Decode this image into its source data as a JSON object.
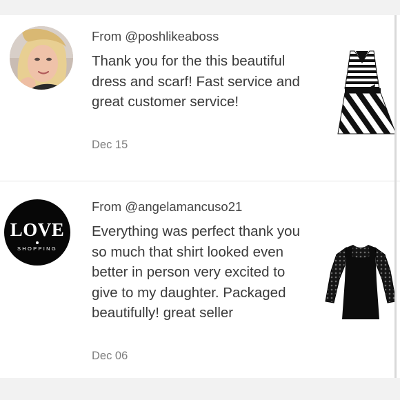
{
  "reviews": [
    {
      "from": "From @poshlikeaboss",
      "text": "Thank you for the this beautiful dress and scarf! Fast service and great customer service!",
      "date": "Dec 15",
      "avatar_type": "photo",
      "product_icon": "striped-dress-icon"
    },
    {
      "from": "From @angelamancuso21",
      "text": "Everything was perfect thank you so much that shirt looked even better in person very excited to give to my daughter. Packaged beautifully! great seller",
      "date": "Dec 06",
      "avatar_logo": {
        "title": "LOVE",
        "subtitle": "SHOPPING"
      },
      "product_icon": "black-lace-top-icon"
    }
  ],
  "colors": {
    "background": "#ffffff",
    "frame": "#f2f2f2",
    "divider": "#e4e4e4",
    "username_text": "#454545",
    "body_text": "#3a3a3a",
    "date_text": "#7d7d7d",
    "logo_background": "#070707"
  }
}
